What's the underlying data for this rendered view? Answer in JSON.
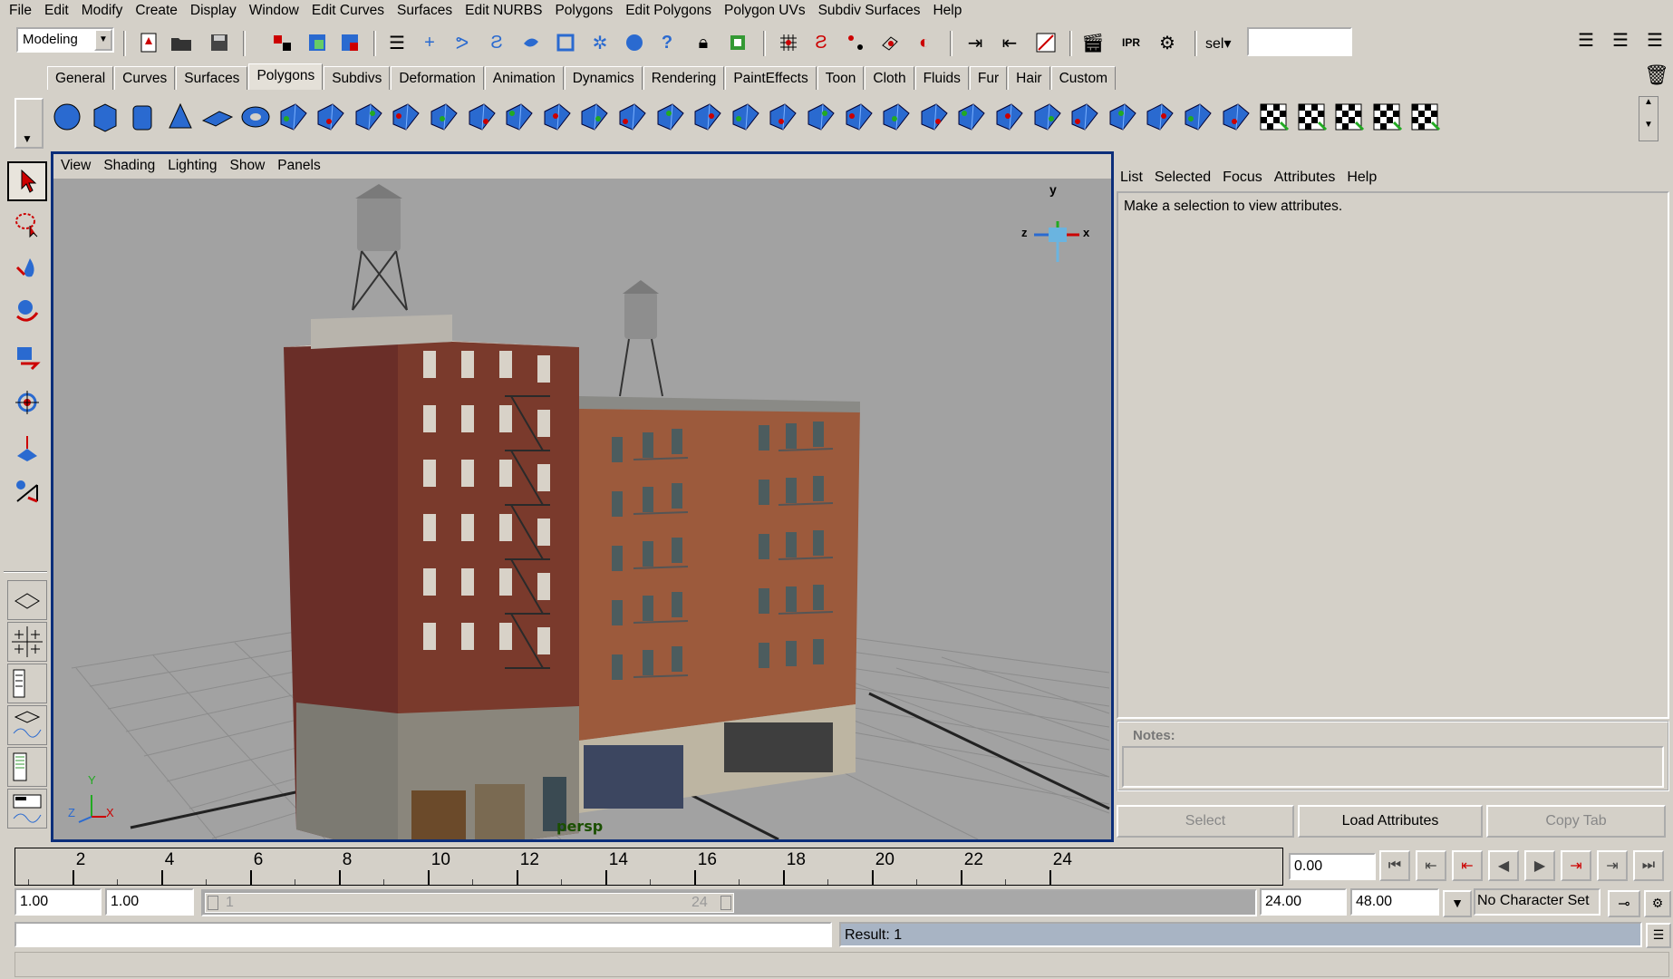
{
  "menubar": [
    "File",
    "Edit",
    "Modify",
    "Create",
    "Display",
    "Window",
    "Edit Curves",
    "Surfaces",
    "Edit NURBS",
    "Polygons",
    "Edit Polygons",
    "Polygon UVs",
    "Subdiv Surfaces",
    "Help"
  ],
  "status_line": {
    "mode": "Modeling",
    "sel_label": "sel",
    "input_value": ""
  },
  "shelf_tabs": [
    "General",
    "Curves",
    "Surfaces",
    "Polygons",
    "Subdivs",
    "Deformation",
    "Animation",
    "Dynamics",
    "Rendering",
    "PaintEffects",
    "Toon",
    "Cloth",
    "Fluids",
    "Fur",
    "Hair",
    "Custom"
  ],
  "active_shelf_tab": "Polygons",
  "viewport": {
    "menu": [
      "View",
      "Shading",
      "Lighting",
      "Show",
      "Panels"
    ],
    "camera": "persp",
    "axis_y": "y",
    "axis_z": "z",
    "axis_x": "x",
    "origin_y": "Y",
    "origin_z": "Z",
    "origin_x": "X"
  },
  "attribute_editor": {
    "menu": [
      "List",
      "Selected",
      "Focus",
      "Attributes",
      "Help"
    ],
    "message": "Make a selection to view attributes.",
    "notes_label": "Notes:",
    "buttons": {
      "select": "Select",
      "load": "Load Attributes",
      "copy": "Copy Tab"
    }
  },
  "timeline": {
    "ticks": [
      "2",
      "4",
      "6",
      "8",
      "10",
      "12",
      "14",
      "16",
      "18",
      "20",
      "22",
      "24"
    ],
    "current_time": "0.00"
  },
  "range": {
    "start": "1.00",
    "playback_start": "1.00",
    "slider_start": "1",
    "slider_end": "24",
    "playback_end": "24.00",
    "end": "48.00",
    "character_set": "No Character Set"
  },
  "command": {
    "input": "",
    "result": "Result: 1"
  },
  "colors": {
    "ui_gray": "#d4d0c8",
    "viewport_border": "#0c2e7a",
    "scene_bg": "#a2a2a2",
    "shelf_blue": "#2a6ad0"
  }
}
